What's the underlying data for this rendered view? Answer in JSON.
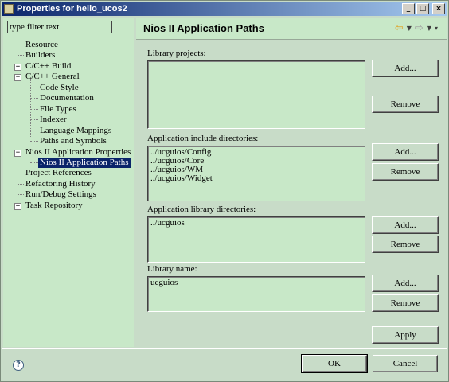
{
  "window": {
    "title": "Properties for hello_ucos2"
  },
  "title_buttons": {
    "minimize": "_",
    "maximize": "□",
    "close": "×"
  },
  "filter": {
    "value": "type filter text"
  },
  "tree": {
    "resource": "Resource",
    "builders": "Builders",
    "cpp_build": "C/C++ Build",
    "cpp_general": "C/C++ General",
    "code_style": "Code Style",
    "documentation": "Documentation",
    "file_types": "File Types",
    "indexer": "Indexer",
    "language_mappings": "Language Mappings",
    "paths_and_symbols": "Paths and Symbols",
    "nios_props": "Nios II Application Properties",
    "nios_paths": "Nios II Application Paths",
    "project_references": "Project References",
    "refactoring_history": "Refactoring History",
    "run_debug": "Run/Debug Settings",
    "task_repository": "Task Repository",
    "toggle_plus": "+",
    "toggle_minus": "−"
  },
  "page": {
    "title": "Nios II Application Paths"
  },
  "nav": {
    "back": "⇦",
    "forward": "⇨",
    "dropdown": "▼",
    "menu": "▾"
  },
  "library_projects": {
    "label": "Library projects:",
    "items": []
  },
  "include_dirs": {
    "label": "Application include directories:",
    "items": [
      "../ucguios/Config",
      "../ucguios/Core",
      "../ucguios/WM",
      "../ucguios/Widget"
    ]
  },
  "library_dirs": {
    "label": "Application library directories:",
    "items": [
      "../ucguios"
    ]
  },
  "library_name": {
    "label": "Library name:",
    "items": [
      "ucguios"
    ]
  },
  "buttons": {
    "add": "Add...",
    "remove": "Remove",
    "apply": "Apply",
    "ok": "OK",
    "cancel": "Cancel"
  },
  "help": {
    "symbol": "?"
  },
  "colors": {
    "panel": "#c8e8c8",
    "selection": "#0a246a",
    "titlebar": "#0a246a"
  }
}
